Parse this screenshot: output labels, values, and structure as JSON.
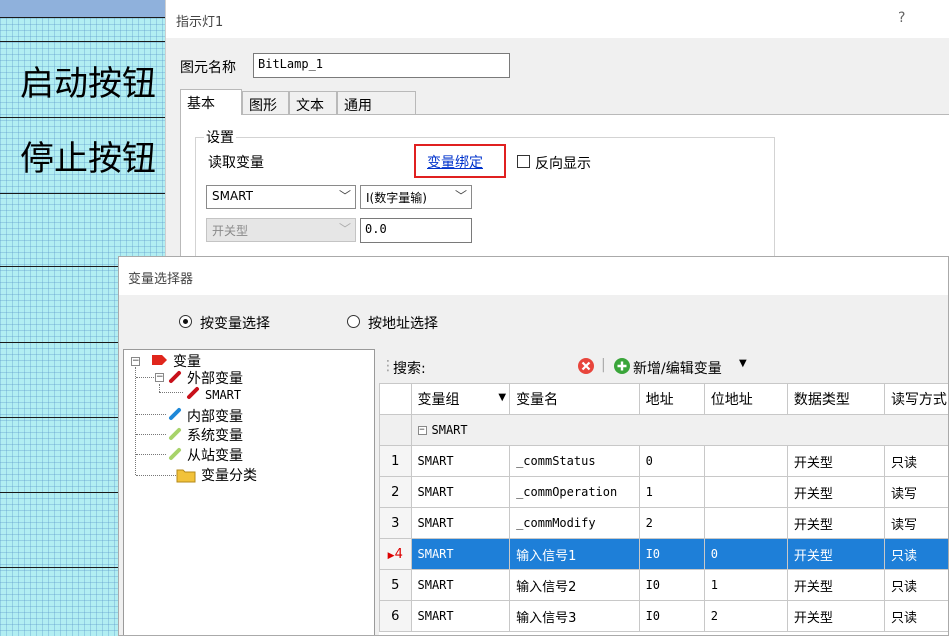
{
  "background": {
    "buttons": [
      "启动按钮",
      "停止按钮"
    ]
  },
  "property_dialog": {
    "title": "指示灯1",
    "help": "?",
    "name_label": "图元名称",
    "name_value": "BitLamp_1",
    "tabs": [
      "基本",
      "图形",
      "文本",
      "通用"
    ],
    "active_tab": "基本",
    "group_title": "设置",
    "read_var_label": "读取变量",
    "bind_link": "变量绑定",
    "reverse_label": "反向显示",
    "reverse_checked": false,
    "device_combo": "SMART",
    "area_combo": "I(数字量输)",
    "type_combo": "开关型",
    "address_value": "0.0",
    "highlight_color": "#e02020"
  },
  "var_selector": {
    "title": "变量选择器",
    "radio_by_var": "按变量选择",
    "radio_by_addr": "按地址选择",
    "selected_mode": "by_var",
    "tree": {
      "root": "变量",
      "children": [
        "外部变量",
        "SMART",
        "内部变量",
        "系统变量",
        "从站变量",
        "变量分类"
      ]
    },
    "search_label": "搜索:",
    "add_edit_label": "新增/编辑变量",
    "columns": [
      "变量组",
      "变量名",
      "地址",
      "位地址",
      "数据类型",
      "读写方式"
    ],
    "group_row": "SMART",
    "rows": [
      {
        "num": "1",
        "group": "SMART",
        "name": "_commStatus",
        "addr": "0",
        "bit": "",
        "dtype": "开关型",
        "rw": "只读"
      },
      {
        "num": "2",
        "group": "SMART",
        "name": "_commOperation",
        "addr": "1",
        "bit": "",
        "dtype": "开关型",
        "rw": "读写"
      },
      {
        "num": "3",
        "group": "SMART",
        "name": "_commModify",
        "addr": "2",
        "bit": "",
        "dtype": "开关型",
        "rw": "读写"
      },
      {
        "num": "4",
        "group": "SMART",
        "name": "输入信号1",
        "addr": "I0",
        "bit": "0",
        "dtype": "开关型",
        "rw": "只读"
      },
      {
        "num": "5",
        "group": "SMART",
        "name": "输入信号2",
        "addr": "I0",
        "bit": "1",
        "dtype": "开关型",
        "rw": "只读"
      },
      {
        "num": "6",
        "group": "SMART",
        "name": "输入信号3",
        "addr": "I0",
        "bit": "2",
        "dtype": "开关型",
        "rw": "只读"
      }
    ],
    "selected_row": "4",
    "selection_color": "#1e7fd8"
  }
}
